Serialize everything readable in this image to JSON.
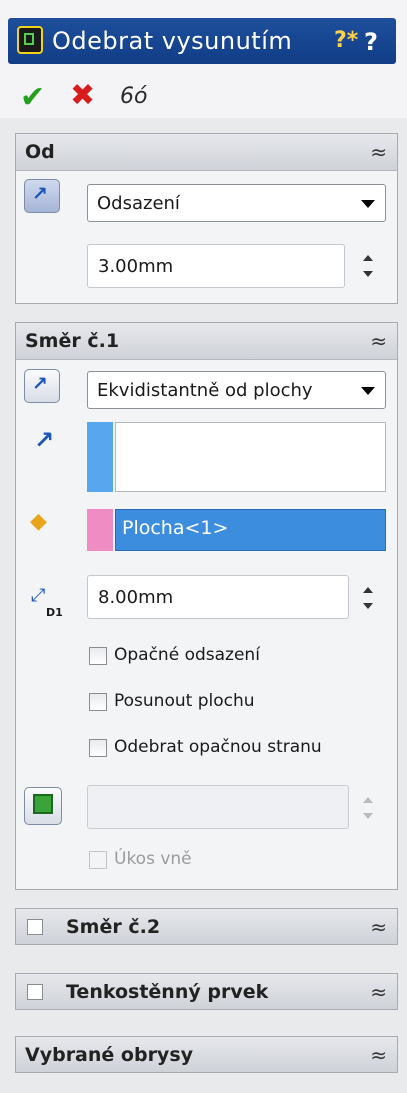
{
  "title": {
    "text": "Odebrat vysunutím",
    "help_icon": "help-icon",
    "question_label": "?"
  },
  "toolbar": {
    "ok_icon": "checkmark-icon",
    "cancel_icon": "cross-icon",
    "preview_icon": "glasses-icon"
  },
  "od": {
    "header": "Od",
    "collapse_glyph": "⌃",
    "start_condition": "Odsazení",
    "offset_value": "3.00mm"
  },
  "smer1": {
    "header": "Směr č.1",
    "end_condition": "Ekvidistantně od plochy",
    "face_selection": "Plocha<1>",
    "depth_value": "8.00mm",
    "depth_badge": "D1",
    "checks": {
      "reverse_offset": "Opačné odsazení",
      "translate_surface": "Posunout plochu",
      "flip_side": "Odebrat opačnou stranu",
      "draft_outward": "Úkos vně"
    }
  },
  "smer2": {
    "header": "Směr č.2"
  },
  "thin": {
    "header": "Tenkostěnný prvek"
  },
  "contours": {
    "header": "Vybrané obrysy"
  },
  "colors": {
    "title_bar": "#1d4f9c",
    "selection_highlight": "#3c8dde",
    "direction_swatch": "#57a7ee",
    "face_swatch": "#f08cc4"
  }
}
